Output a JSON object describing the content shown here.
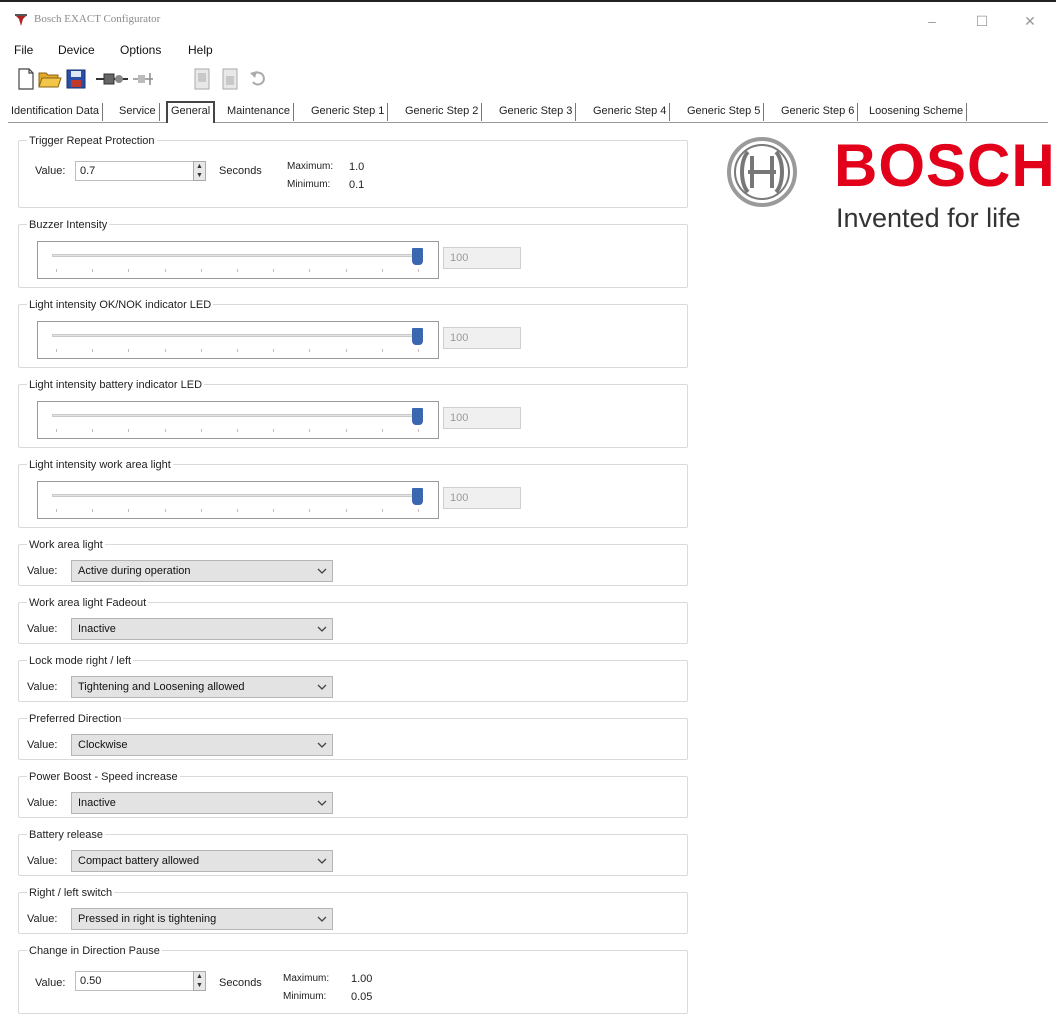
{
  "window": {
    "title": "Bosch EXACT Configurator",
    "min_glyph": "–",
    "max_glyph": "☐",
    "close_glyph": "✕"
  },
  "menu": [
    "File",
    "Device",
    "Options",
    "Help"
  ],
  "toolbar": {
    "icons": [
      "new-file-icon",
      "open-folder-icon",
      "save-icon",
      "connect-device-icon",
      "disconnect-device-icon",
      "read-device-icon",
      "write-device-icon",
      "undo-icon"
    ]
  },
  "tabs": [
    "Identification Data",
    "Service",
    "General",
    "Maintenance",
    "Generic Step 1",
    "Generic Step 2",
    "Generic Step 3",
    "Generic Step 4",
    "Generic Step 5",
    "Generic Step 6",
    "Loosening Scheme"
  ],
  "active_tab": "General",
  "trigger_repeat": {
    "title": "Trigger Repeat Protection",
    "value_label": "Value:",
    "value": "0.7",
    "unit": "Seconds",
    "max_label": "Maximum:",
    "max": "1.0",
    "min_label": "Minimum:",
    "min": "0.1"
  },
  "sliders": [
    {
      "title": "Buzzer Intensity",
      "value": "100",
      "level": 1.0
    },
    {
      "title": "Light intensity OK/NOK indicator LED",
      "value": "100",
      "level": 1.0
    },
    {
      "title": "Light intensity battery indicator LED",
      "value": "100",
      "level": 1.0
    },
    {
      "title": "Light intensity work area light",
      "value": "100",
      "level": 1.0
    }
  ],
  "combos": [
    {
      "title": "Work area light",
      "value_label": "Value:",
      "value": "Active during operation"
    },
    {
      "title": "Work area light Fadeout",
      "value_label": "Value:",
      "value": "Inactive"
    },
    {
      "title": "Lock mode right / left",
      "value_label": "Value:",
      "value": "Tightening and Loosening allowed"
    },
    {
      "title": "Preferred Direction",
      "value_label": "Value:",
      "value": "Clockwise"
    },
    {
      "title": "Power Boost - Speed increase",
      "value_label": "Value:",
      "value": "Inactive"
    },
    {
      "title": "Battery release",
      "value_label": "Value:",
      "value": "Compact battery allowed"
    },
    {
      "title": "Right / left switch",
      "value_label": "Value:",
      "value": "Pressed in right is tightening"
    }
  ],
  "direction_pause": {
    "title": "Change in Direction Pause",
    "value_label": "Value:",
    "value": "0.50",
    "unit": "Seconds",
    "max_label": "Maximum:",
    "max": "1.00",
    "min_label": "Minimum:",
    "min": "0.05"
  },
  "logo": {
    "word": "BOSCH",
    "tagline": "Invented for life",
    "brand_color": "#e2001a"
  }
}
